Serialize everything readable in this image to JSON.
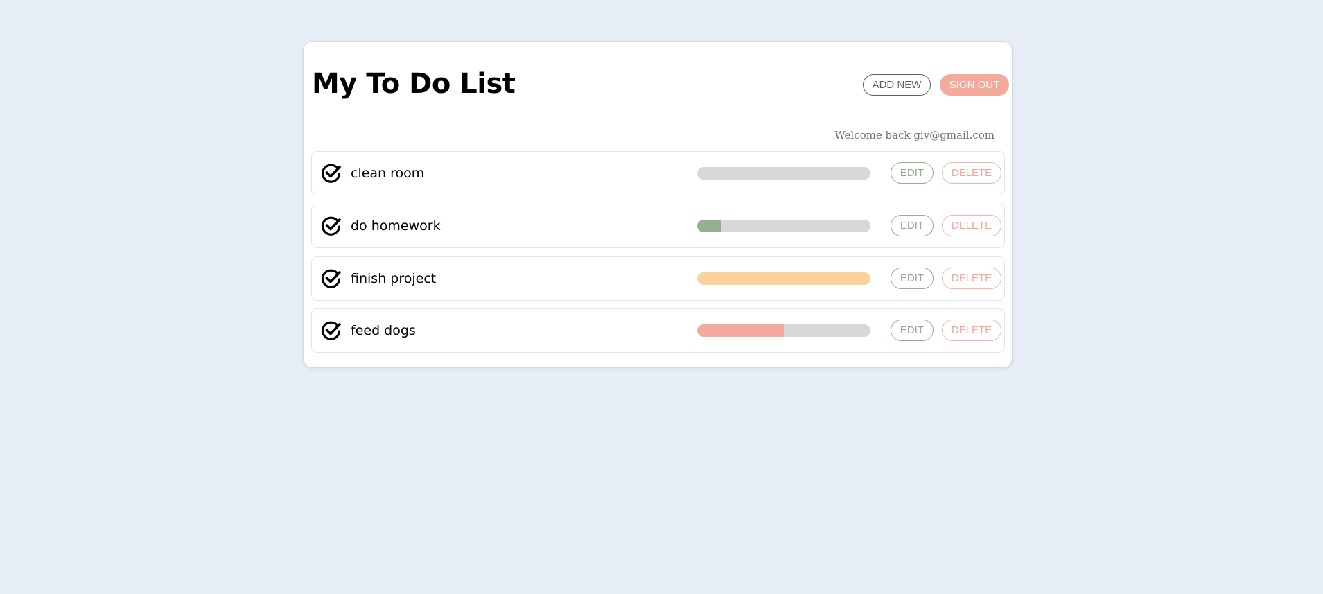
{
  "header": {
    "title": "My To Do List",
    "add_new_label": "ADD NEW",
    "sign_out_label": "SIGN OUT"
  },
  "welcome_text": "Welcome back giv@gmail.com",
  "colors": {
    "background": "#e8eef7",
    "track": "#d8d8d8",
    "progress_green": "#93b08f",
    "progress_orange": "#f9d29c",
    "progress_red": "#f3aa9c",
    "sign_out_bg": "#f3aa9c"
  },
  "tasks": [
    {
      "label": "clean room",
      "progress": 0,
      "color": "#93b08f",
      "edit_label": "EDIT",
      "delete_label": "DELETE",
      "icon": "check-circle-icon"
    },
    {
      "label": "do homework",
      "progress": 0.14,
      "color": "#93b08f",
      "edit_label": "EDIT",
      "delete_label": "DELETE",
      "icon": "check-circle-icon"
    },
    {
      "label": "finish project",
      "progress": 1.0,
      "color": "#f9d29c",
      "edit_label": "EDIT",
      "delete_label": "DELETE",
      "icon": "check-circle-icon"
    },
    {
      "label": "feed dogs",
      "progress": 0.5,
      "color": "#f3aa9c",
      "edit_label": "EDIT",
      "delete_label": "DELETE",
      "icon": "check-circle-icon"
    }
  ]
}
